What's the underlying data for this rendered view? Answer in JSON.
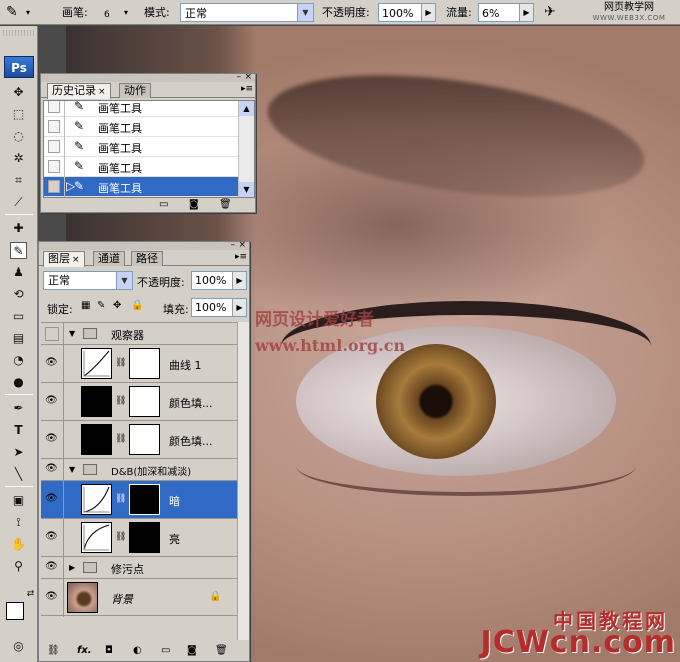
{
  "options_bar": {
    "brush_label": "画笔:",
    "brush_size": "6",
    "mode_label": "模式:",
    "mode_value": "正常",
    "opacity_label": "不透明度:",
    "opacity_value": "100%",
    "flow_label": "流量:",
    "flow_value": "6%",
    "site_name": "网页教学网",
    "site_url": "WWW.WEB3X.COM"
  },
  "toolbox": {
    "logo": "Ps"
  },
  "history_panel": {
    "tabs": [
      {
        "label": "历史记录",
        "active": true
      },
      {
        "label": "动作",
        "active": false
      }
    ],
    "items": [
      {
        "label": "画笔工具",
        "selected": false
      },
      {
        "label": "画笔工具",
        "selected": false
      },
      {
        "label": "画笔工具",
        "selected": false
      },
      {
        "label": "画笔工具",
        "selected": false
      },
      {
        "label": "画笔工具",
        "selected": true
      }
    ]
  },
  "layers_panel": {
    "tabs": [
      {
        "label": "图层",
        "active": true
      },
      {
        "label": "通道",
        "active": false
      },
      {
        "label": "路径",
        "active": false
      }
    ],
    "blend_mode": "正常",
    "opacity_label": "不透明度:",
    "opacity_value": "100%",
    "lock_label": "锁定:",
    "fill_label": "填充:",
    "fill_value": "100%",
    "layers": [
      {
        "name": "观察器",
        "type": "group"
      },
      {
        "name": "曲线 1",
        "type": "adjustment"
      },
      {
        "name": "颜色填...",
        "type": "fill"
      },
      {
        "name": "颜色填...",
        "type": "fill"
      },
      {
        "name": "D&B(加深和减淡)",
        "type": "group"
      },
      {
        "name": "暗",
        "type": "adjustment"
      },
      {
        "name": "亮",
        "type": "adjustment"
      },
      {
        "name": "修污点",
        "type": "group"
      },
      {
        "name": "背景",
        "type": "background"
      }
    ]
  },
  "watermarks": {
    "cn_title": "网页设计爱好者",
    "url": "www.html.org.cn",
    "brand_cn": "中国教程网",
    "brand_en": "JCWcn.com"
  },
  "colors": {
    "panel_bg": "#d4d0c8",
    "selection": "#316ac5"
  }
}
